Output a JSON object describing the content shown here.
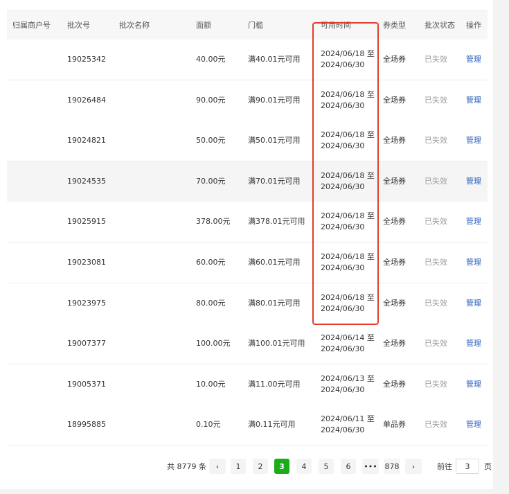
{
  "table": {
    "headers": [
      "归属商户号",
      "批次号",
      "批次名称",
      "面额",
      "门槛",
      "可用时间",
      "券类型",
      "批次状态",
      "操作"
    ],
    "rows": [
      {
        "merchant": "",
        "batch_id": "19025342",
        "name": "",
        "amount": "40.00元",
        "threshold": "满40.01元可用",
        "date_start": "2024/06/18 至",
        "date_end": "2024/06/30",
        "type": "全场券",
        "status": "已失效",
        "action": "管理"
      },
      {
        "merchant": "",
        "batch_id": "19026484",
        "name": "",
        "amount": "90.00元",
        "threshold": "满90.01元可用",
        "date_start": "2024/06/18 至",
        "date_end": "2024/06/30",
        "type": "全场券",
        "status": "已失效",
        "action": "管理"
      },
      {
        "merchant": "",
        "batch_id": "19024821",
        "name": "",
        "amount": "50.00元",
        "threshold": "满50.01元可用",
        "date_start": "2024/06/18 至",
        "date_end": "2024/06/30",
        "type": "全场券",
        "status": "已失效",
        "action": "管理"
      },
      {
        "merchant": "",
        "batch_id": "19024535",
        "name": "",
        "amount": "70.00元",
        "threshold": "满70.01元可用",
        "date_start": "2024/06/18 至",
        "date_end": "2024/06/30",
        "type": "全场券",
        "status": "已失效",
        "action": "管理"
      },
      {
        "merchant": "",
        "batch_id": "19025915",
        "name": "",
        "amount": "378.00元",
        "threshold": "满378.01元可用",
        "date_start": "2024/06/18 至",
        "date_end": "2024/06/30",
        "type": "全场券",
        "status": "已失效",
        "action": "管理"
      },
      {
        "merchant": "",
        "batch_id": "19023081",
        "name": "",
        "amount": "60.00元",
        "threshold": "满60.01元可用",
        "date_start": "2024/06/18 至",
        "date_end": "2024/06/30",
        "type": "全场券",
        "status": "已失效",
        "action": "管理"
      },
      {
        "merchant": "",
        "batch_id": "19023975",
        "name": "",
        "amount": "80.00元",
        "threshold": "满80.01元可用",
        "date_start": "2024/06/18 至",
        "date_end": "2024/06/30",
        "type": "全场券",
        "status": "已失效",
        "action": "管理"
      },
      {
        "merchant": "",
        "batch_id": "19007377",
        "name": "",
        "amount": "100.00元",
        "threshold": "满100.01元可用",
        "date_start": "2024/06/14 至",
        "date_end": "2024/06/30",
        "type": "全场券",
        "status": "已失效",
        "action": "管理"
      },
      {
        "merchant": "",
        "batch_id": "19005371",
        "name": "",
        "amount": "10.00元",
        "threshold": "满11.00元可用",
        "date_start": "2024/06/13 至",
        "date_end": "2024/06/30",
        "type": "全场券",
        "status": "已失效",
        "action": "管理"
      },
      {
        "merchant": "",
        "batch_id": "18995885",
        "name": "",
        "amount": "0.10元",
        "threshold": "满0.11元可用",
        "date_start": "2024/06/11 至",
        "date_end": "2024/06/30",
        "type": "单品券",
        "status": "已失效",
        "action": "管理"
      }
    ]
  },
  "pagination": {
    "total": "共 8779 条",
    "prev": "‹",
    "pages": [
      "1",
      "2",
      "3",
      "4",
      "5",
      "6",
      "•••",
      "878"
    ],
    "next": "›",
    "goto_label": "前往",
    "goto_value": "3",
    "goto_suffix": "页"
  },
  "colors": {
    "highlight_box": "#e33b2c",
    "active_page": "#1aad19",
    "link": "#2a5dbb"
  },
  "icons": {
    "prev": "chevron-left-icon",
    "next": "chevron-right-icon",
    "ellipsis": "more-pages-icon"
  }
}
